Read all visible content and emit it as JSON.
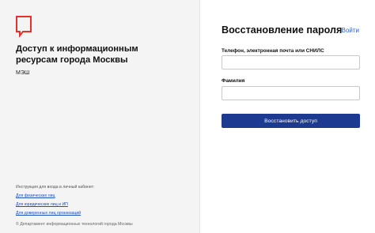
{
  "brand": {
    "logo_icon": "mos-ru-logo-icon",
    "accent_color": "#e5312b"
  },
  "left_panel": {
    "title": "Доступ к информационным ресурсам города Москвы",
    "service_name": "МЭШ",
    "instructions_label": "Инструкция для входа в личный кабинет:",
    "links": [
      {
        "label": "Для физических лиц"
      },
      {
        "label": "Для юридических лиц и ИП"
      },
      {
        "label": "Для доверенных лиц организаций"
      }
    ],
    "copyright": "© Департамент информационных технологий города Москвы"
  },
  "form": {
    "title": "Восстановление пароля",
    "login_link": "Войти",
    "fields": [
      {
        "label": "Телефон, электронная почта или СНИЛС",
        "value": ""
      },
      {
        "label": "Фамилия",
        "value": ""
      }
    ],
    "submit_label": "Восстановить доступ",
    "button_color": "#1c3a8f"
  }
}
